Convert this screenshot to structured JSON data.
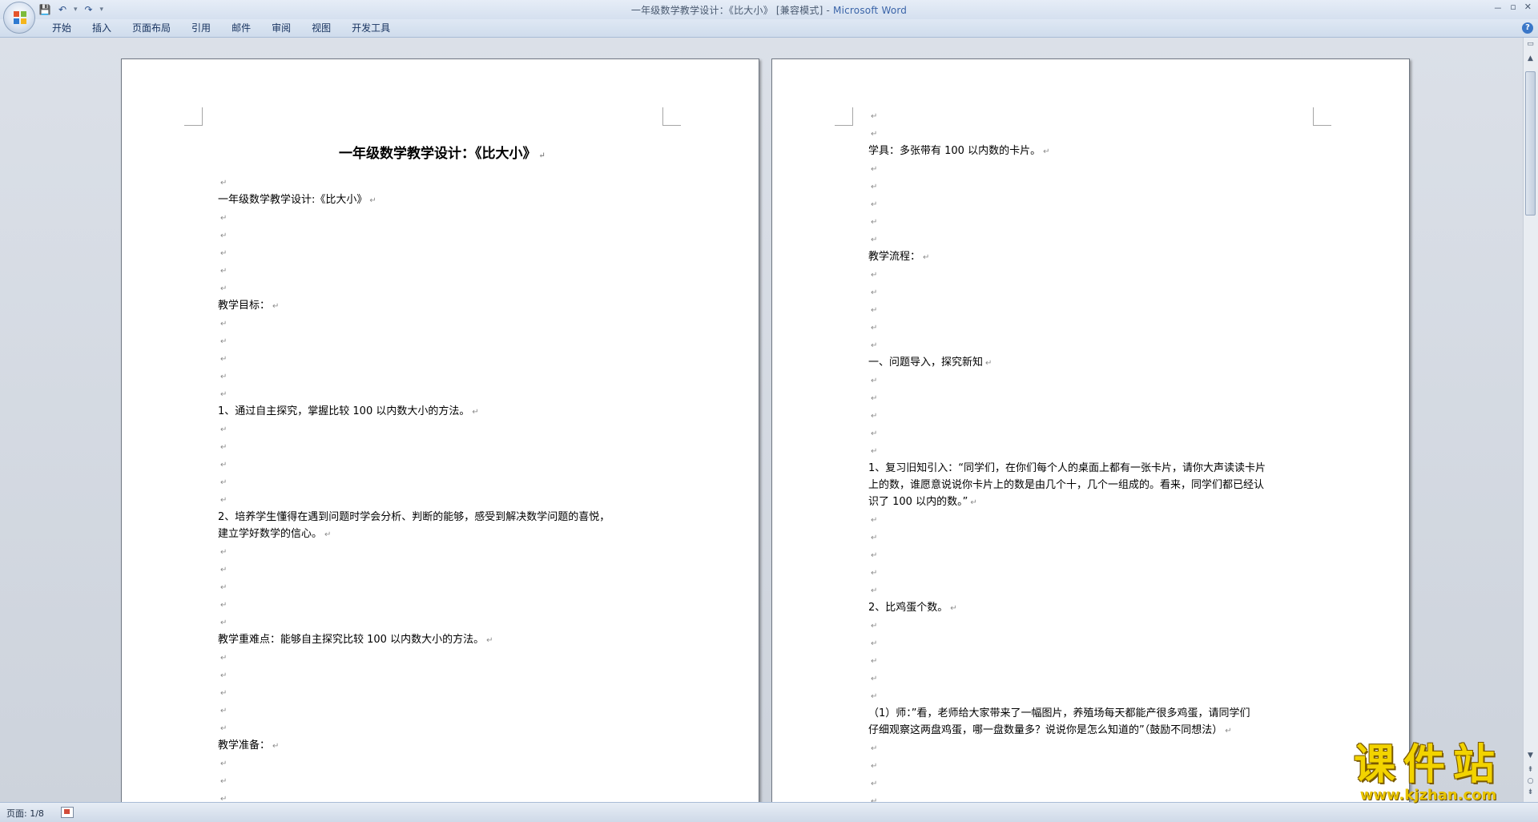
{
  "window": {
    "title": "一年级数学教学设计：《比大小》 [兼容模式] - ",
    "app_name": "Microsoft Word",
    "controls": [
      "－",
      "▫",
      "✕"
    ]
  },
  "qat": {
    "save": "💾",
    "undo": "↶",
    "redo": "↷",
    "more": "▾"
  },
  "ribbon": {
    "tabs": [
      "开始",
      "插入",
      "页面布局",
      "引用",
      "邮件",
      "审阅",
      "视图",
      "开发工具"
    ],
    "help": "?"
  },
  "pilcrow": "↵",
  "page1": {
    "title": "一年级数学教学设计：《比大小》",
    "lines": [
      "",
      "一年级数学教学设计:《比大小》",
      "",
      "",
      "",
      "",
      "",
      "教学目标：",
      "",
      "",
      "",
      "",
      "",
      "1、通过自主探究，掌握比较 100 以内数大小的方法。",
      "",
      "",
      "",
      "",
      "",
      "2、培养学生懂得在遇到问题时学会分析、判断的能够，感受到解决数学问题的喜悦，",
      "建立学好数学的信心。",
      "",
      "",
      "",
      "",
      "",
      "教学重难点：能够自主探究比较 100 以内数大小的方法。",
      "",
      "",
      "",
      "",
      "",
      "教学准备：",
      "",
      "",
      "",
      "",
      ""
    ]
  },
  "page2": {
    "lines": [
      "",
      "",
      "学具：多张带有 100 以内数的卡片。",
      "",
      "",
      "",
      "",
      "",
      "教学流程：",
      "",
      "",
      "",
      "",
      "",
      "一、问题导入，探究新知",
      "",
      "",
      "",
      "",
      "",
      "1、复习旧知引入：“同学们，在你们每个人的桌面上都有一张卡片，请你大声读读卡片",
      "上的数，谁愿意说说你卡片上的数是由几个十，几个一组成的。看来，同学们都已经认",
      "识了 100 以内的数。”",
      "",
      "",
      "",
      "",
      "",
      "2、比鸡蛋个数。",
      "",
      "",
      "",
      "",
      "",
      "（1）师：”看，老师给大家带来了一幅图片，养殖场每天都能产很多鸡蛋，请同学们",
      "仔细观察这两盘鸡蛋，哪一盘数量多？说说你是怎么知道的”（鼓励不同想法）",
      "",
      "",
      "",
      ""
    ]
  },
  "status": {
    "page_indicator": "页面: 1/8"
  },
  "watermark": {
    "title": "课件站",
    "url": "www.kjzhan.com"
  }
}
